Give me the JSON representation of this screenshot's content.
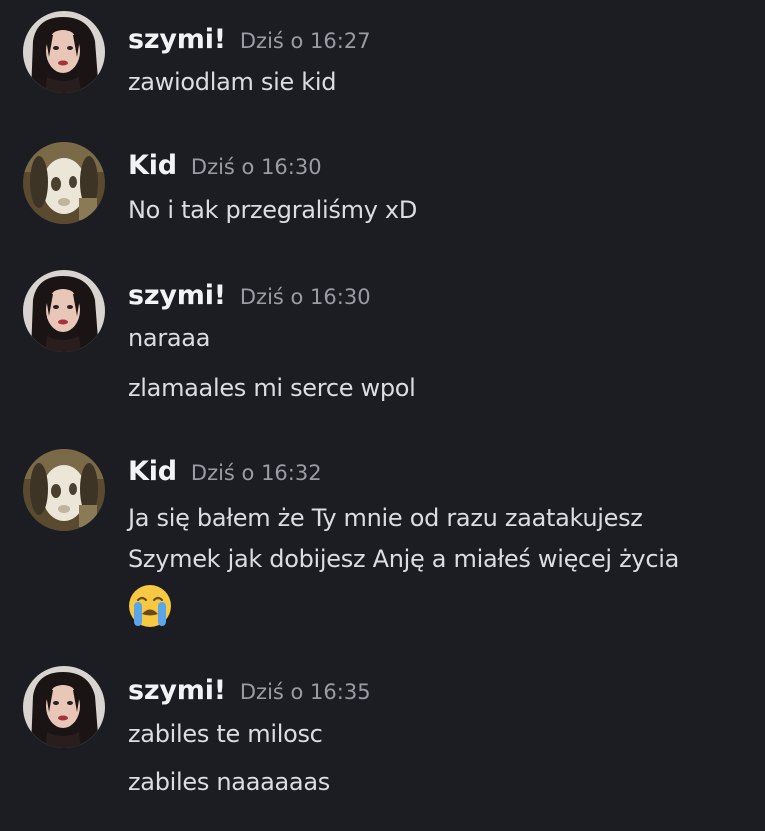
{
  "messages": [
    {
      "author": "szymi!",
      "time": "Dziś o 16:27",
      "lines": [
        "zawiodlam sie kid"
      ]
    },
    {
      "author": "Kid",
      "time": "Dziś o 16:30",
      "lines": [
        "No i tak przegraliśmy xD"
      ]
    },
    {
      "author": "szymi!",
      "time": "Dziś o 16:30",
      "lines": [
        "naraaa",
        "zlamaales mi serce wpol"
      ]
    },
    {
      "author": "Kid",
      "time": "Dziś o 16:32",
      "lines": [
        "Ja się bałem że Ty mnie od razu zaatakujesz",
        "Szymek jak dobijesz Anję a miałeś więcej życia"
      ],
      "emoji": "loudly-crying-face-emoji"
    },
    {
      "author": "szymi!",
      "time": "Dziś o 16:35",
      "lines": [
        "zabiles te milosc",
        "zabiles naaaaaas"
      ]
    }
  ],
  "colors": {
    "background": "#1c1d23",
    "username": "#f2f3f5",
    "timestamp": "#9b9ca3",
    "message_text": "#dcdde1"
  }
}
